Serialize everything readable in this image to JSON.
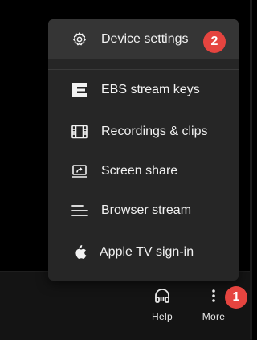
{
  "menu": {
    "items": [
      {
        "label": "Device settings",
        "icon": "gear-icon",
        "active": true
      },
      {
        "label": "EBS stream keys",
        "icon": "ebs-logo-icon"
      },
      {
        "label": "Recordings & clips",
        "icon": "film-icon"
      },
      {
        "label": "Screen share",
        "icon": "screen-share-icon"
      },
      {
        "label": "Browser stream",
        "icon": "browser-stream-icon"
      },
      {
        "label": "Apple TV sign-in",
        "icon": "apple-icon"
      }
    ]
  },
  "toolbar": {
    "help_label": "Help",
    "more_label": "More"
  },
  "annotations": {
    "step_1": "1",
    "step_2": "2",
    "color": "#e5443f"
  }
}
